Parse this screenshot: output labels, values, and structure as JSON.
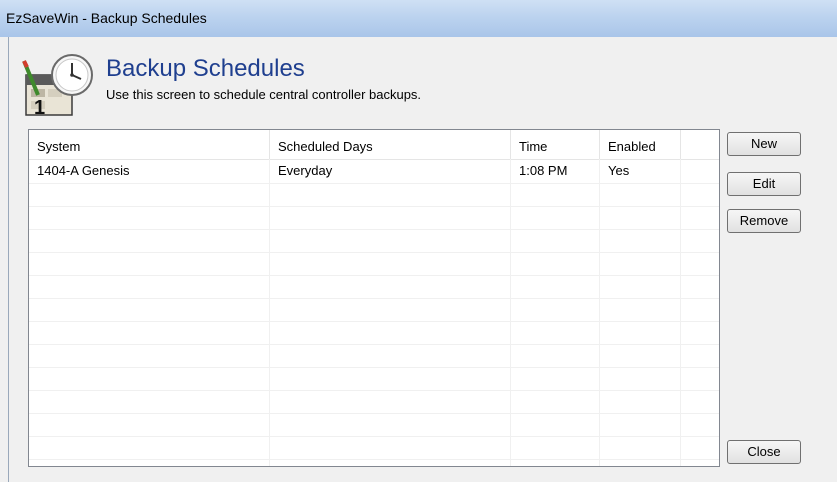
{
  "window": {
    "title": "EzSaveWin - Backup Schedules"
  },
  "header": {
    "title": "Backup Schedules",
    "subtitle": "Use this screen to schedule central controller backups.",
    "icon": "calendar-clock-icon"
  },
  "table": {
    "columns": [
      "System",
      "Scheduled Days",
      "Time",
      "Enabled"
    ],
    "rows": [
      {
        "system": "1404-A Genesis",
        "days": "Everyday",
        "time": "1:08 PM",
        "enabled": "Yes"
      }
    ]
  },
  "buttons": {
    "new": "New",
    "edit": "Edit",
    "remove": "Remove",
    "close": "Close"
  },
  "colors": {
    "title_blue": "#1f3f8f",
    "titlebar": "#bcd3ef"
  }
}
